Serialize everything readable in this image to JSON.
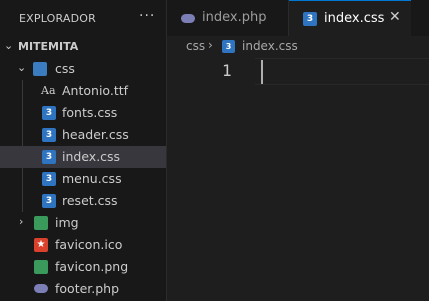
{
  "explorer": {
    "title": "EXPLORADOR",
    "more_icon": "ellipsis-icon",
    "project": "MITEMITA",
    "tree": [
      {
        "label": "css",
        "icon": "folder-css-icon",
        "expanded": true
      },
      {
        "label": "Antonio.ttf",
        "icon": "font-file-icon"
      },
      {
        "label": "fonts.css",
        "icon": "css-file-icon"
      },
      {
        "label": "header.css",
        "icon": "css-file-icon"
      },
      {
        "label": "index.css",
        "icon": "css-file-icon",
        "selected": true
      },
      {
        "label": "menu.css",
        "icon": "css-file-icon"
      },
      {
        "label": "reset.css",
        "icon": "css-file-icon"
      },
      {
        "label": "img",
        "icon": "folder-img-icon",
        "expanded": false
      },
      {
        "label": "favicon.ico",
        "icon": "favicon-icon"
      },
      {
        "label": "favicon.png",
        "icon": "image-file-icon"
      },
      {
        "label": "footer.php",
        "icon": "php-file-icon"
      }
    ]
  },
  "tabs": [
    {
      "label": "index.php",
      "icon": "php-file-icon",
      "active": false
    },
    {
      "label": "index.css",
      "icon": "css-file-icon",
      "active": true
    }
  ],
  "breadcrumbs": {
    "folder": "css",
    "separator": "›",
    "file": "index.css"
  },
  "editor": {
    "line_number": "1"
  },
  "colors": {
    "accent": "#0078d4",
    "css_icon": "#2f74c0",
    "folder_img": "#3a9a5b",
    "favicon": "#d9412c",
    "php_icon": "#7b7fb5"
  }
}
